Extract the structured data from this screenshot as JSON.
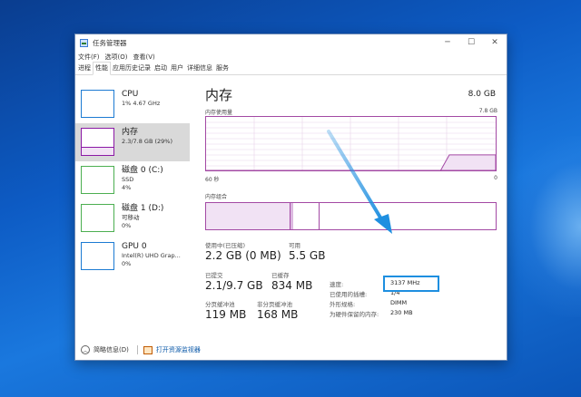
{
  "window": {
    "title": "任务管理器",
    "controls": [
      "─",
      "☐",
      "✕"
    ]
  },
  "menu": [
    "文件(F)",
    "选项(O)",
    "查看(V)"
  ],
  "tabs": [
    "进程",
    "性能",
    "应用历史记录",
    "启动",
    "用户",
    "详细信息",
    "服务"
  ],
  "active_tab": "性能",
  "sidebar": [
    {
      "title": "CPU",
      "sub1": "1% 4.67 GHz",
      "sub2": "",
      "color": "#1c7bd3"
    },
    {
      "title": "内存",
      "sub1": "2.3/7.8 GB (29%)",
      "sub2": "",
      "color": "#8b18a5"
    },
    {
      "title": "磁盘 0 (C:)",
      "sub1": "SSD",
      "sub2": "4%",
      "color": "#4caf50"
    },
    {
      "title": "磁盘 1 (D:)",
      "sub1": "可移动",
      "sub2": "0%",
      "color": "#4caf50"
    },
    {
      "title": "GPU 0",
      "sub1": "Intel(R) UHD Grap...",
      "sub2": "0%",
      "color": "#1c7bd3"
    }
  ],
  "main": {
    "title": "内存",
    "total": "8.0 GB",
    "usage_label": "内存使用量",
    "usage_max": "7.8 GB",
    "time_left": "60 秒",
    "time_right": "0",
    "composition_label": "内存组合",
    "usage_fraction": 0.29,
    "in_use_label": "使用中(已压缩)",
    "in_use_value": "2.2 GB (0 MB)",
    "available_label": "可用",
    "available_value": "5.5 GB",
    "committed_label": "已提交",
    "committed_value": "2.1/9.7 GB",
    "cached_label": "已缓存",
    "cached_value": "834 MB",
    "paged_label": "分页缓冲池",
    "paged_value": "119 MB",
    "nonpaged_label": "非分页缓冲池",
    "nonpaged_value": "168 MB",
    "speed_label": "速度:",
    "speed_value": "3137 MHz",
    "slots_label": "已使用的插槽:",
    "slots_value": "1/4",
    "form_label": "外形规格:",
    "form_value": "DIMM",
    "reserved_label": "为硬件保留的内存:",
    "reserved_value": "230 MB"
  },
  "footer": {
    "brief_label": "简略信息(D)",
    "monitor_label": "打开资源监视器"
  },
  "colors": {
    "memory_accent": "#a349a4",
    "highlight": "#1e8fe0"
  }
}
